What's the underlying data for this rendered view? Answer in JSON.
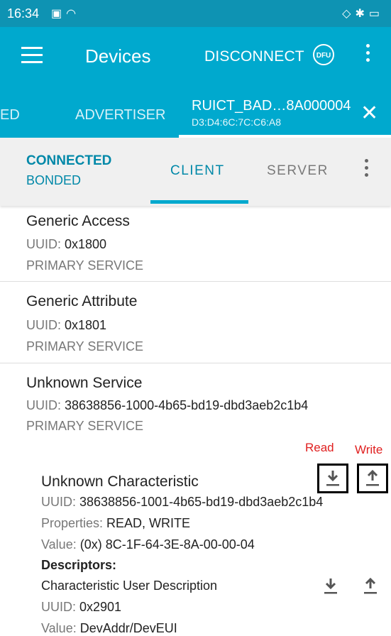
{
  "status_bar": {
    "time": "16:34"
  },
  "app_bar": {
    "title": "Devices",
    "disconnect": "DISCONNECT",
    "dfu": "DFU"
  },
  "device_tabs": {
    "partial_tab": "ED",
    "advertiser": "ADVERTISER",
    "device_name": "RUICT_BAD…8A000004",
    "device_address": "D3:D4:6C:7C:C6:A8"
  },
  "connection": {
    "state": "CONNECTED",
    "bond": "BONDED",
    "tab_client": "CLIENT",
    "tab_server": "SERVER"
  },
  "services": [
    {
      "name": "Generic Access",
      "uuid_label": "UUID: ",
      "uuid": "0x1800",
      "type": "PRIMARY SERVICE"
    },
    {
      "name": "Generic Attribute",
      "uuid_label": "UUID: ",
      "uuid": "0x1801",
      "type": "PRIMARY SERVICE"
    },
    {
      "name": "Unknown Service",
      "uuid_label": "UUID: ",
      "uuid": "38638856-1000-4b65-bd19-dbd3aeb2c1b4",
      "type": "PRIMARY SERVICE"
    }
  ],
  "characteristic": {
    "name": "Unknown Characteristic",
    "uuid_label": "UUID: ",
    "uuid": "38638856-1001-4b65-bd19-dbd3aeb2c1b4",
    "properties_label": "Properties: ",
    "properties": "READ, WRITE",
    "value_label": "Value: ",
    "value": "(0x) 8C-1F-64-3E-8A-00-00-04",
    "descriptors_label": "Descriptors:"
  },
  "descriptor": {
    "name": "Characteristic User Description",
    "uuid_label": "UUID: ",
    "uuid": "0x2901",
    "value_label": "Value: ",
    "value": "DevAddr/DevEUI"
  },
  "annotations": {
    "read": "Read",
    "write": "Write"
  },
  "colors": {
    "accent": "#00a9ce",
    "status_bar": "#0e93b3",
    "annotation": "#e02020"
  }
}
